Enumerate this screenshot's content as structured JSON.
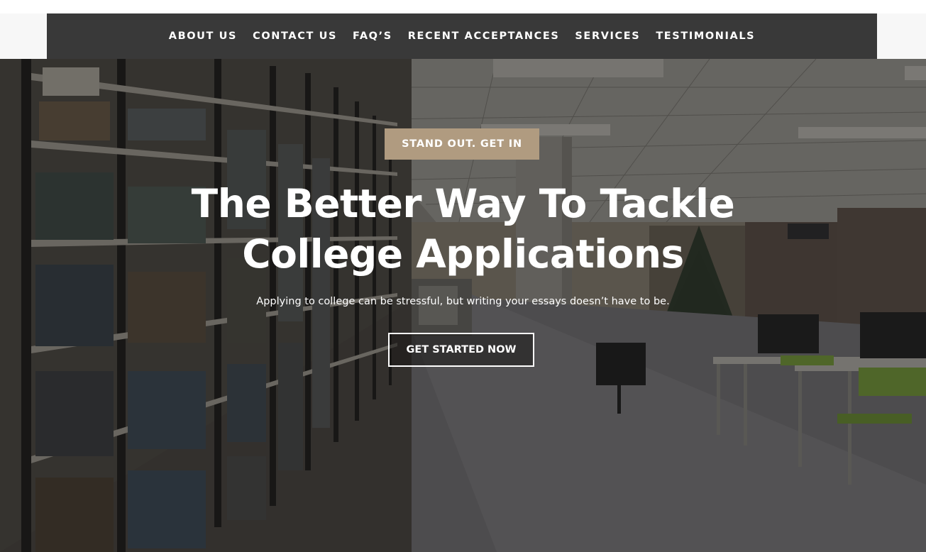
{
  "nav": {
    "items": [
      {
        "label": "ABOUT US"
      },
      {
        "label": "CONTACT US"
      },
      {
        "label": "FAQ’S"
      },
      {
        "label": "RECENT ACCEPTANCES"
      },
      {
        "label": "SERVICES"
      },
      {
        "label": "TESTIMONIALS"
      }
    ]
  },
  "hero": {
    "eyebrow": "STAND OUT. GET IN",
    "headline_line1": "The Better Way To Tackle",
    "headline_line2": "College Applications",
    "subtext": "Applying to college can be stressful, but writing your essays doesn’t have to be.",
    "cta_label": "GET STARTED NOW"
  },
  "colors": {
    "nav_background": "#393939",
    "eyebrow_background": "#b09b80",
    "text": "#ffffff"
  }
}
